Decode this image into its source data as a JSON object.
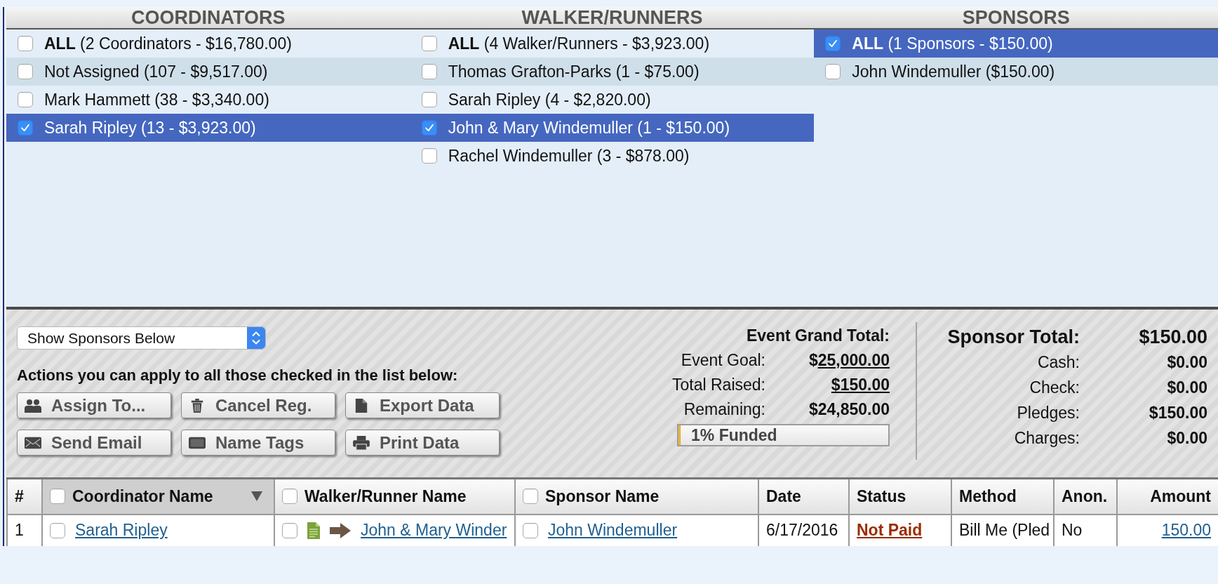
{
  "lists": [
    {
      "title": "COORDINATORS",
      "items": [
        {
          "label": "**ALL** (2 Coordinators - $16,780.00)",
          "checked": false,
          "selected": false
        },
        {
          "label": "Not Assigned (107 - $9,517.00)",
          "checked": false,
          "selected": false
        },
        {
          "label": "Mark Hammett (38 - $3,340.00)",
          "checked": false,
          "selected": false
        },
        {
          "label": "Sarah Ripley (13 - $3,923.00)",
          "checked": true,
          "selected": true
        }
      ]
    },
    {
      "title": "WALKER/RUNNERS",
      "items": [
        {
          "label": "**ALL** (4 Walker/Runners - $3,923.00)",
          "checked": false,
          "selected": false
        },
        {
          "label": "Thomas Grafton-Parks (1 - $75.00)",
          "checked": false,
          "selected": false
        },
        {
          "label": "Sarah Ripley (4 - $2,820.00)",
          "checked": false,
          "selected": false
        },
        {
          "label": "John & Mary Windemuller (1 - $150.00)",
          "checked": true,
          "selected": true
        },
        {
          "label": "Rachel Windemuller (3 - $878.00)",
          "checked": false,
          "selected": false
        }
      ]
    },
    {
      "title": "SPONSORS",
      "items": [
        {
          "label": "**ALL** (1 Sponsors - $150.00)",
          "checked": true,
          "selected": true
        },
        {
          "label": "John Windemuller ($150.00)",
          "checked": false,
          "selected": false
        }
      ]
    }
  ],
  "view_select": {
    "value": "Show Sponsors Below"
  },
  "actions": {
    "caption": "Actions you can apply to all those checked in the list below:",
    "buttons": [
      "Assign To...",
      "Cancel Reg.",
      "Export Data",
      "Send Email",
      "Name Tags",
      "Print Data"
    ]
  },
  "event_totals": {
    "title": "Event Grand Total:",
    "rows": [
      {
        "label": "Event Goal:",
        "prefix": "$",
        "value": "25,000.00",
        "kind": "link"
      },
      {
        "label": "Total Raised:",
        "value": "$150.00",
        "kind": "link"
      },
      {
        "label": "Remaining:",
        "value": "$24,850.00",
        "kind": "plain"
      }
    ],
    "progress": {
      "label": "1% Funded",
      "level": 0.01
    }
  },
  "sponsor_totals": {
    "title": "Sponsor Total:",
    "total": "$150.00",
    "rows": [
      {
        "label": "Cash:",
        "value": "$0.00"
      },
      {
        "label": "Check:",
        "value": "$0.00"
      },
      {
        "label": "Pledges:",
        "value": "$150.00"
      },
      {
        "label": "Charges:",
        "value": "$0.00"
      }
    ]
  },
  "table": {
    "columns": [
      {
        "label": "#",
        "sorted": false
      },
      {
        "label": "Coordinator Name",
        "checked": false,
        "sorted": true
      },
      {
        "label": "Walker/Runner Name",
        "checked": false,
        "sorted": false
      },
      {
        "label": "Sponsor Name",
        "checked": false,
        "sorted": false
      },
      {
        "label": "Date",
        "sorted": false
      },
      {
        "label": "Status",
        "sorted": false
      },
      {
        "label": "Method",
        "sorted": false
      },
      {
        "label": "Anon.",
        "sorted": false
      },
      {
        "label": "Amount",
        "sorted": false
      }
    ],
    "rows": [
      {
        "cells": [
          {
            "kind": "text",
            "text": "1"
          },
          {
            "kind": "link",
            "text": "Sarah Ripley",
            "checked": false
          },
          {
            "kind": "record",
            "text": "John & Mary Winder",
            "checked": false
          },
          {
            "kind": "link",
            "text": "John Windemuller",
            "checked": false
          },
          {
            "kind": "text",
            "text": "6/17/2016"
          },
          {
            "kind": "status",
            "text": "Not Paid",
            "paid": false
          },
          {
            "kind": "text",
            "text": "Bill Me (Pled"
          },
          {
            "kind": "text",
            "text": "No"
          },
          {
            "kind": "amount",
            "text": "150.00"
          }
        ]
      }
    ]
  }
}
